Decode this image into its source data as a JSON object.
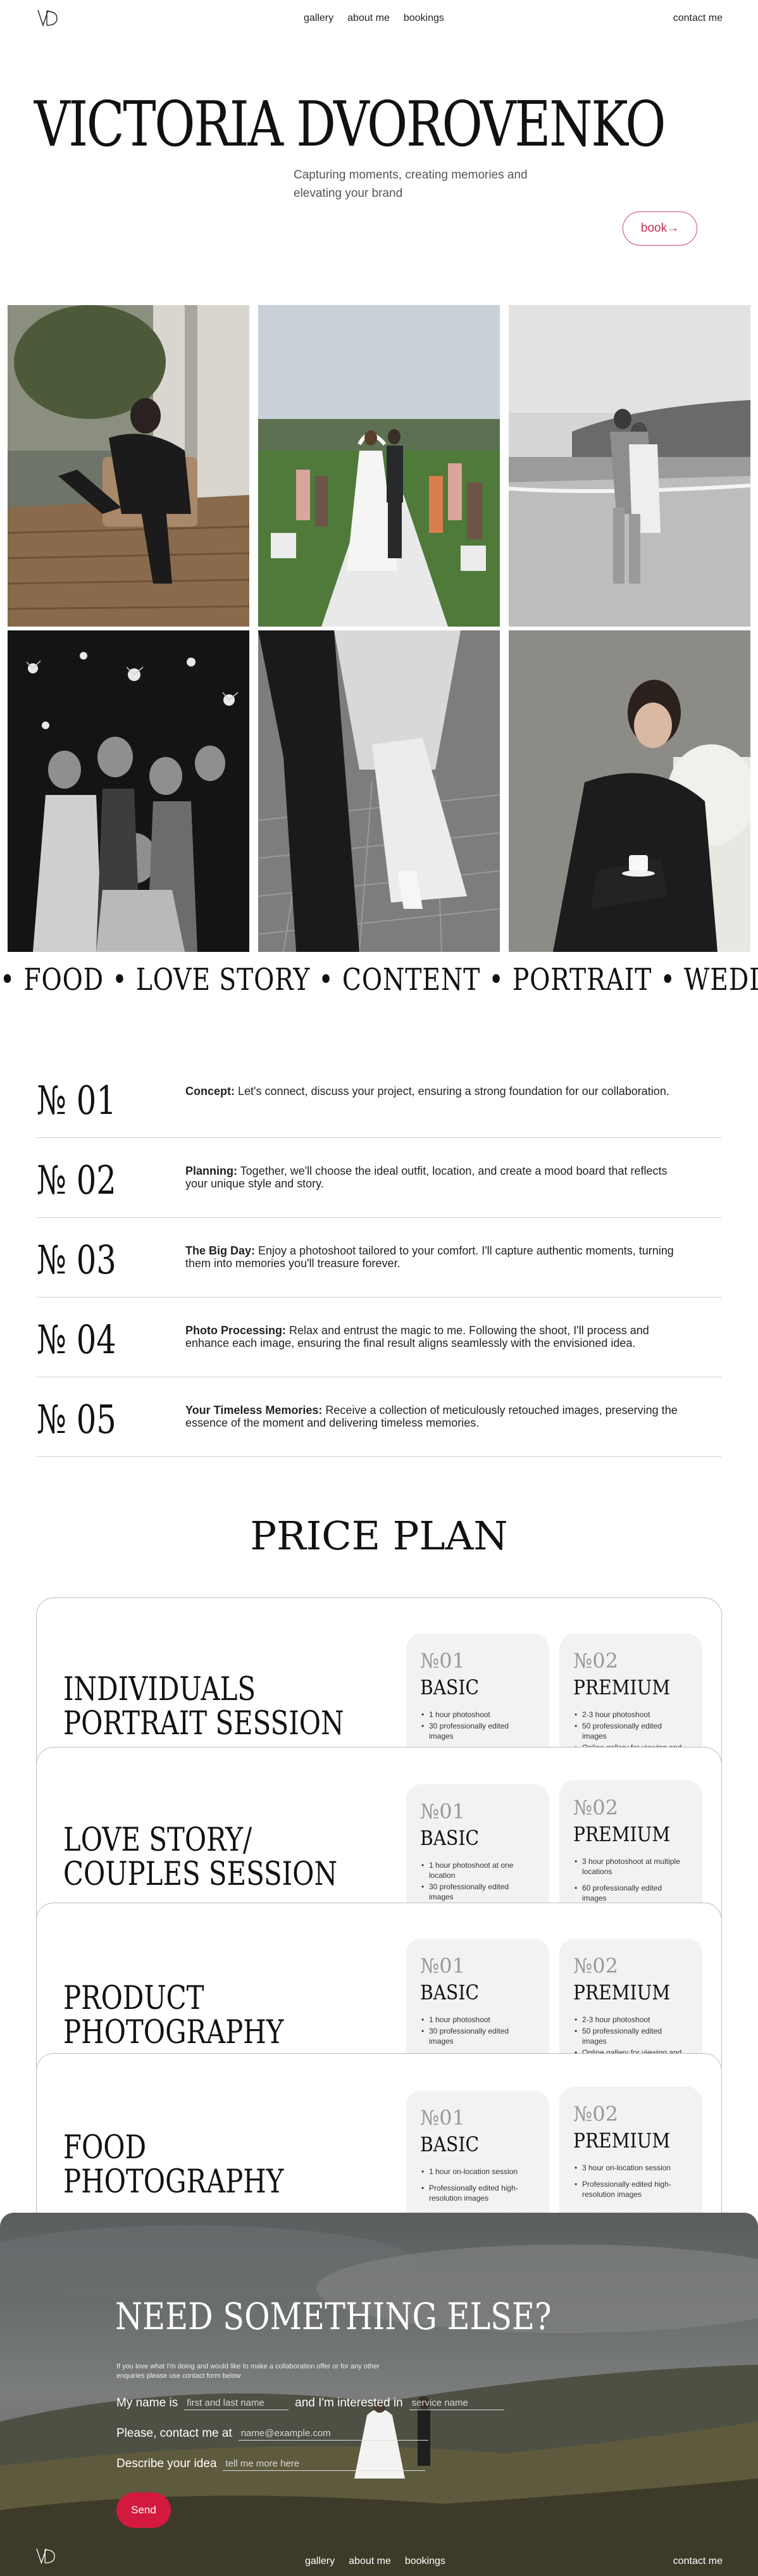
{
  "header": {
    "nav": [
      "gallery",
      "about me",
      "bookings"
    ],
    "contact": "contact me"
  },
  "hero": {
    "title": "VICTORIA DVOROVENKO",
    "subtitle": "Capturing moments, creating memories and elevating your brand",
    "book": "book→"
  },
  "marquee": "• FOOD • LOVE STORY • CONTENT • PORTRAIT • WEDDING • FOOD • LOVE STORY",
  "steps": [
    {
      "num": "№ 01",
      "title": "Concept:",
      "text": " Let's connect, discuss your project, ensuring a strong foundation for our collaboration."
    },
    {
      "num": "№ 02",
      "title": "Planning:",
      "text": " Together, we'll choose the ideal outfit, location, and create a mood board that reflects your unique style and story."
    },
    {
      "num": "№ 03",
      "title": "The Big Day:",
      "text": " Enjoy a photoshoot tailored to your comfort. I'll capture authentic moments, turning them into memories you'll treasure forever."
    },
    {
      "num": "№ 04",
      "title": "Photo Processing:",
      "text": " Relax and entrust the magic to me. Following the shoot, I'll process and enhance each image, ensuring the final result aligns seamlessly with the envisioned idea."
    },
    {
      "num": "№ 05",
      "title": "Your Timeless Memories:",
      "text": " Receive a collection of meticulously retouched images, preserving the essence of the moment and delivering timeless memories."
    }
  ],
  "price_title": "PRICE PLAN",
  "price_cards": [
    {
      "title_1": "INDIVIDUALS",
      "title_2": "PORTRAIT SESSION",
      "basic": {
        "num": "№01",
        "name": "BASIC",
        "items": [
          "1 hour photoshoot",
          "30 professionally edited images"
        ]
      },
      "premium": {
        "num": "№02",
        "name": "PREMIUM",
        "items": [
          "2-3 hour photoshoot",
          "50 professionally edited images",
          "Online gallery for viewing and"
        ]
      }
    },
    {
      "title_1": "LOVE STORY/",
      "title_2": "COUPLES SESSION",
      "basic": {
        "num": "№01",
        "name": "BASIC",
        "items": [
          "1 hour photoshoot at one location",
          "30 professionally edited images"
        ]
      },
      "premium": {
        "num": "№02",
        "name": "PREMIUM",
        "items": [
          "3 hour photoshoot at multiple locations",
          "60 professionally edited images"
        ]
      }
    },
    {
      "title_1": "PRODUCT",
      "title_2": "PHOTOGRAPHY",
      "basic": {
        "num": "№01",
        "name": "BASIC",
        "items": [
          "1 hour photoshoot",
          "30 professionally edited images"
        ]
      },
      "premium": {
        "num": "№02",
        "name": "PREMIUM",
        "items": [
          "2-3 hour photoshoot",
          "50 professionally edited images",
          "Online gallery for viewing and"
        ]
      }
    },
    {
      "title_1": "FOOD",
      "title_2": "PHOTOGRAPHY",
      "basic": {
        "num": "№01",
        "name": "BASIC",
        "items": [
          "1 hour on-location session",
          "Professionally edited high-resolution images"
        ]
      },
      "premium": {
        "num": "№02",
        "name": "PREMIUM",
        "items": [
          "3 hour on-location session",
          "Professionally edited high-resolution images"
        ]
      }
    }
  ],
  "contact": {
    "title": "NEED SOMETHING ELSE?",
    "small": "If you love what I'm doing and would like to make a collaboration offer or for any other enquiries please use contact form below",
    "name_label": "My name is",
    "name_placeholder": "first and last name",
    "interest_label": "and I'm interested in",
    "interest_placeholder": "service name",
    "email_label": "Please, contact me at",
    "email_placeholder": "name@example.com",
    "idea_label": "Describe your idea",
    "idea_placeholder": "tell me more here",
    "send": "Send"
  },
  "footer": {
    "nav": [
      "gallery",
      "about me",
      "bookings"
    ],
    "contact": "contact me"
  },
  "colors": {
    "accent": "#d3193d",
    "book_border": "#d24a64"
  }
}
